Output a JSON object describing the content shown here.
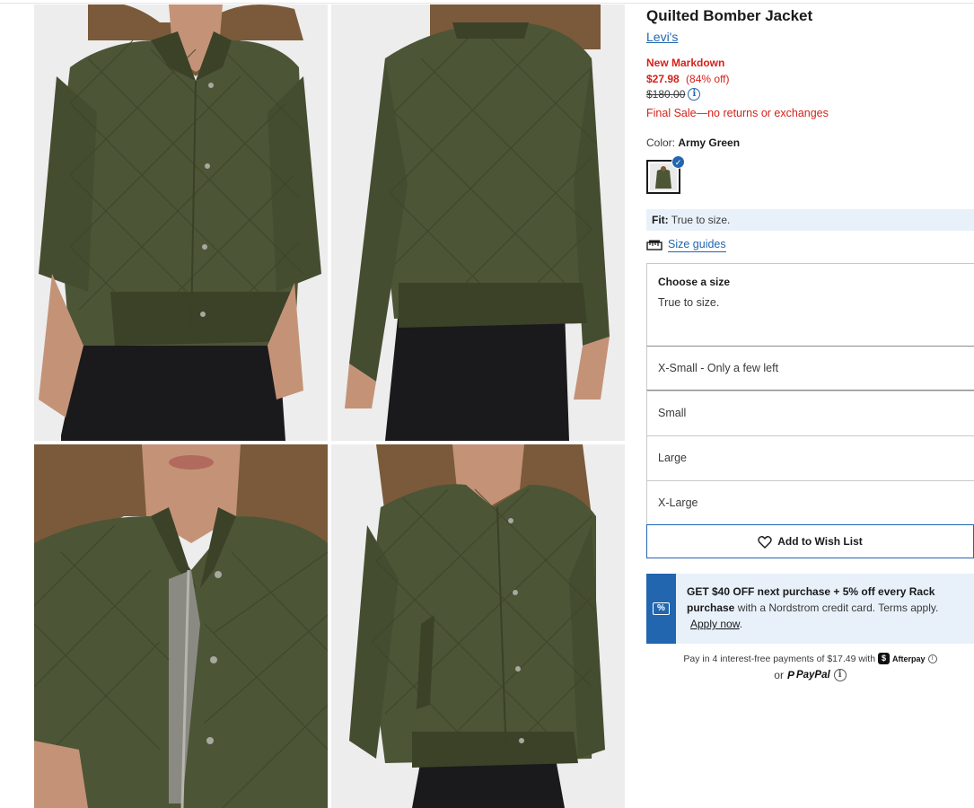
{
  "product": {
    "title": "Quilted Bomber Jacket",
    "brand": "Levi's",
    "markdown_label": "New Markdown",
    "price_now": "$27.98",
    "discount": "(84% off)",
    "price_was": "$180.00",
    "final_sale": "Final Sale—no returns or exchanges",
    "color_label": "Color:",
    "color_value": "Army Green",
    "fit_label": "Fit:",
    "fit_value": "True to size.",
    "size_guides": "Size guides"
  },
  "size_selector": {
    "heading": "Choose a size",
    "subheading": "True to size.",
    "options": [
      "X-Small - Only a few left",
      "Small",
      "Large",
      "X-Large"
    ]
  },
  "wishlist_button": "Add to Wish List",
  "promo": {
    "bold": "GET $40 OFF next purchase + 5% off every Rack purchase",
    "rest": "with a Nordstrom credit card. Terms apply.",
    "link": "Apply now",
    "after_link": "."
  },
  "payments": {
    "installments": "Pay in 4 interest-free payments of $17.49 with",
    "afterpay": "Afterpay",
    "or": "or",
    "paypal": "PayPal"
  },
  "colors": {
    "accent_blue": "#2266b0",
    "sale_red": "#d4221b",
    "jacket_green": "#4c5536",
    "light_blue_bg": "#e8f1fa"
  },
  "icons": [
    "info-icon",
    "checkmark-icon",
    "ruler-icon",
    "heart-icon",
    "percent-icon",
    "afterpay-icon",
    "paypal-icon"
  ]
}
